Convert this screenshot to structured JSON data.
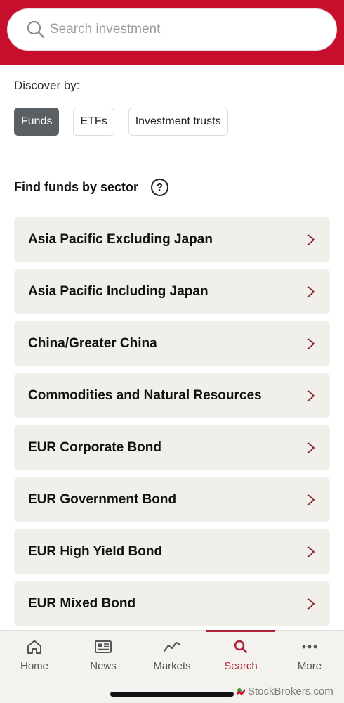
{
  "search": {
    "placeholder": "Search investment",
    "value": ""
  },
  "discover": {
    "label": "Discover by:",
    "chips": [
      {
        "label": "Funds",
        "active": true
      },
      {
        "label": "ETFs",
        "active": false
      },
      {
        "label": "Investment trusts",
        "active": false
      }
    ]
  },
  "sectors": {
    "title": "Find funds by sector",
    "help_icon": "question-circle-icon",
    "items": [
      {
        "label": "Asia Pacific Excluding Japan"
      },
      {
        "label": "Asia Pacific Including Japan"
      },
      {
        "label": "China/Greater China"
      },
      {
        "label": "Commodities and Natural Resources"
      },
      {
        "label": "EUR Corporate Bond"
      },
      {
        "label": "EUR Government Bond"
      },
      {
        "label": "EUR High Yield Bond"
      },
      {
        "label": "EUR Mixed Bond"
      }
    ]
  },
  "nav": {
    "items": [
      {
        "label": "Home",
        "icon": "home-icon"
      },
      {
        "label": "News",
        "icon": "newspaper-icon"
      },
      {
        "label": "Markets",
        "icon": "line-chart-icon"
      },
      {
        "label": "Search",
        "icon": "search-icon",
        "active": true
      },
      {
        "label": "More",
        "icon": "more-dots-icon"
      }
    ]
  },
  "watermark": {
    "text": "StockBrokers.com"
  },
  "colors": {
    "brand": "#c8102e",
    "active": "#b0233a",
    "chip_active": "#5a5f63",
    "card": "#f1efe9"
  }
}
